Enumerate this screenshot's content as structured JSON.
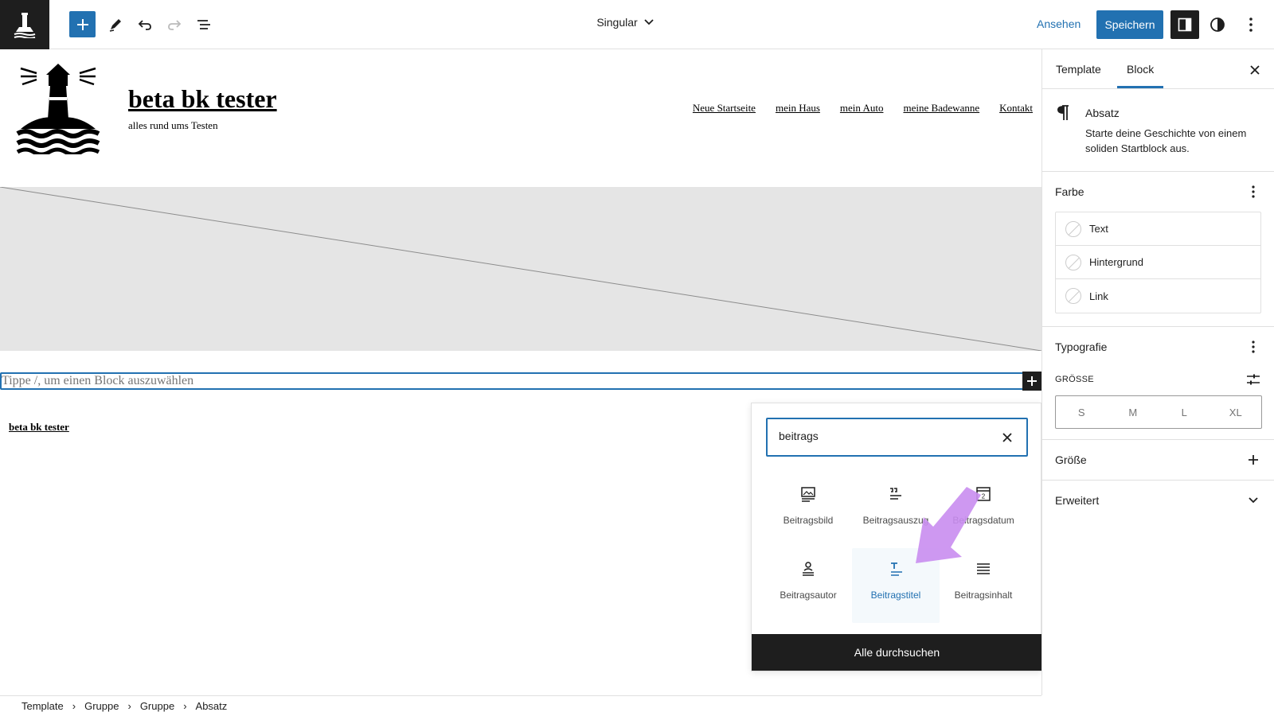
{
  "header": {
    "document_title": "Singular",
    "view_label": "Ansehen",
    "save_label": "Speichern"
  },
  "site": {
    "title": "beta bk tester",
    "tagline": "alles rund ums Testen",
    "nav": [
      "Neue Startseite",
      "mein Haus",
      "mein Auto",
      "meine Badewanne",
      "Kontakt"
    ],
    "footer_title": "beta bk tester"
  },
  "editor": {
    "paragraph_placeholder": "Tippe /, um einen Block auszuwählen"
  },
  "inserter": {
    "search_value": "beitrags",
    "blocks": [
      {
        "label": "Beitragsbild",
        "icon": "post-featured-image-icon",
        "active": false
      },
      {
        "label": "Beitragsauszug",
        "icon": "post-excerpt-icon",
        "active": false
      },
      {
        "label": "Beitragsdatum",
        "icon": "post-date-icon",
        "active": false
      },
      {
        "label": "Beitragsautor",
        "icon": "post-author-icon",
        "active": false
      },
      {
        "label": "Beitragstitel",
        "icon": "post-title-icon",
        "active": true
      },
      {
        "label": "Beitragsinhalt",
        "icon": "post-content-icon",
        "active": false
      }
    ],
    "browse_all_label": "Alle durchsuchen",
    "annotation_arrow_color": "#c98df0"
  },
  "sidebar": {
    "tabs": [
      "Template",
      "Block"
    ],
    "active_tab": "Block",
    "block_card": {
      "title": "Absatz",
      "description": "Starte deine Geschichte von einem soliden Startblock aus."
    },
    "color_panel": {
      "title": "Farbe",
      "items": [
        "Text",
        "Hintergrund",
        "Link"
      ]
    },
    "typography_panel": {
      "title": "Typografie",
      "size_label": "GRÖSSE",
      "sizes": [
        "S",
        "M",
        "L",
        "XL"
      ]
    },
    "dimensions_panel": {
      "title": "Größe"
    },
    "advanced_panel": {
      "title": "Erweitert"
    }
  },
  "breadcrumb": [
    "Template",
    "Gruppe",
    "Gruppe",
    "Absatz"
  ],
  "colors": {
    "accent": "#2271b1",
    "dark": "#1e1e1e",
    "placeholder_bg": "#e5e5e5"
  }
}
